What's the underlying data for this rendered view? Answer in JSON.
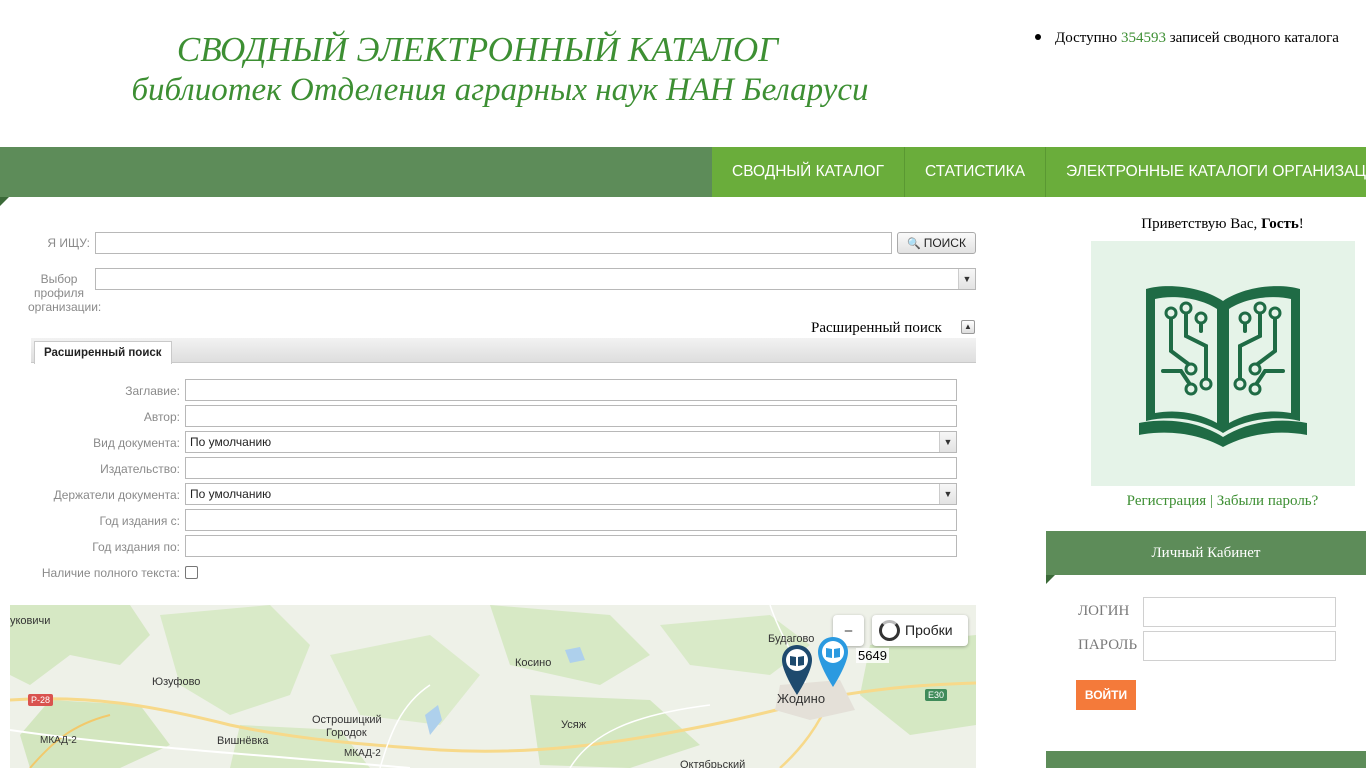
{
  "header": {
    "title_line1": "СВОДНЫЙ ЭЛЕКТРОННЫЙ КАТАЛОГ",
    "title_line2": "библиотек Отделения аграрных наук НАН Беларуси",
    "stats_prefix": "Доступно",
    "stats_count": "354593",
    "stats_suffix": "записей сводного каталога"
  },
  "nav": {
    "items": [
      {
        "label": "СВОДНЫЙ КАТАЛОГ"
      },
      {
        "label": "СТАТИСТИКА"
      },
      {
        "label": "ЭЛЕКТРОННЫЕ КАТАЛОГИ ОРГАНИЗАЦИЙ"
      }
    ]
  },
  "search": {
    "query_label": "Я ИЩУ:",
    "query_value": "",
    "button_label": "ПОИСК",
    "profile_label": "Выбор профиля организации:",
    "profile_value": "",
    "advanced_link": "Расширенный поиск",
    "advanced_tab": "Расширенный поиск",
    "fields": {
      "title_label": "Заглавие:",
      "author_label": "Автор:",
      "doctype_label": "Вид документа:",
      "doctype_value": "По умолчанию",
      "publisher_label": "Издательство:",
      "holders_label": "Держатели документа:",
      "holders_value": "По умолчанию",
      "year_from_label": "Год издания с:",
      "year_to_label": "Год издания по:",
      "fulltext_label": "Наличие полного текста:"
    }
  },
  "map": {
    "traffic_label": "Пробки",
    "pin_count": "5649",
    "places": [
      "Буда­гово",
      "Косино",
      "Юзуфово",
      "Острошицкий Городок",
      "Вишнёвка",
      "Усяж",
      "Жодино",
      "Октябрьский",
      "МКАД-2",
      "МКАД-2",
      "P-28",
      "E30",
      "кович"
    ],
    "place_labels": {
      "budagovo": "Будагово",
      "kosino": "Косино",
      "yuzufovo": "Юзуфово",
      "ostroshitsky1": "Острошицкий",
      "ostroshitsky2": "Городок",
      "vishnevka": "Вишнёвка",
      "usyazh": "Усяж",
      "zhodino": "Жодино",
      "oktyabrsky": "Октябрьский",
      "mkad_a": "МКАД-2",
      "mkad_b": "МКАД-2",
      "kovichi": "уковичи"
    },
    "shields": {
      "p28": "Р-28",
      "e30": "E30"
    }
  },
  "sidebar": {
    "greeting_prefix": "Приветствую Вас,",
    "greeting_user": "Гость",
    "greeting_suffix": "!",
    "register_link": "Регистрация",
    "separator": "|",
    "forgot_link": "Забыли пароль?",
    "cabinet_title": "Личный Кабинет",
    "login_label": "ЛОГИН",
    "password_label": "ПАРОЛЬ",
    "login_button": "ВОЙТИ"
  },
  "colors": {
    "brand_green": "#3d8f33",
    "nav_green": "#5d8c59",
    "menu_green": "#6aad3b",
    "login_orange": "#f47a3a"
  }
}
